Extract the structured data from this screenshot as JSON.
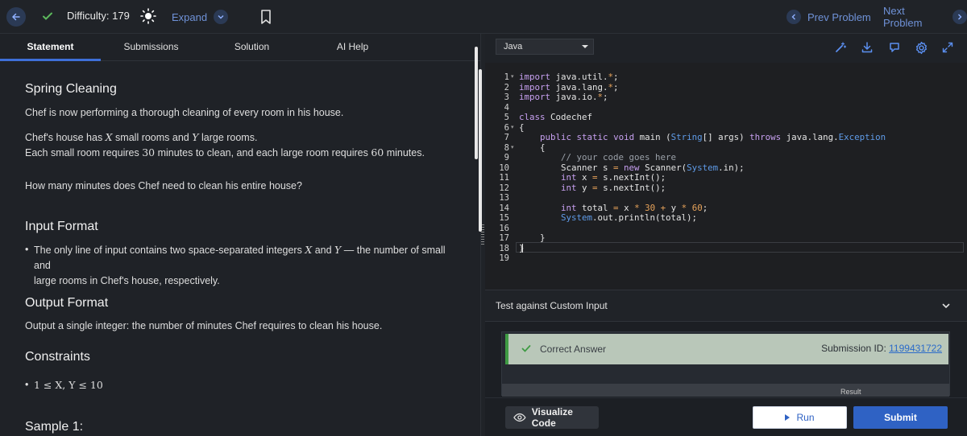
{
  "topbar": {
    "difficulty": "Difficulty: 179",
    "expand_label": "Expand",
    "prev_label": "Prev Problem",
    "next_label": "Next Problem"
  },
  "tabs": [
    {
      "label": "Statement"
    },
    {
      "label": "Submissions"
    },
    {
      "label": "Solution"
    },
    {
      "label": "AI Help"
    }
  ],
  "statement": {
    "title": "Spring Cleaning",
    "p1": "Chef is now performing a thorough cleaning of every room in his house.",
    "p2_a": "Chef's house has ",
    "var_x": "X",
    "p2_b": " small rooms and ",
    "var_y": "Y",
    "p2_c": " large rooms.",
    "p3_a": "Each small room requires ",
    "num_30": "30",
    "p3_b": " minutes to clean, and each large room requires ",
    "num_60": "60",
    "p3_c": " minutes.",
    "p4": "How many minutes does Chef need to clean his entire house?",
    "input_heading": "Input Format",
    "input_a": "The only line of input contains two space-separated integers ",
    "input_b": " and ",
    "input_c": " — the number of small and",
    "input_d": "large rooms in Chef's house, respectively.",
    "output_heading": "Output Format",
    "output_text": "Output a single integer: the number of minutes Chef requires to clean his house.",
    "constraints_heading": "Constraints",
    "constraint": "1 ≤ X, Y ≤ 10",
    "sample_heading": "Sample 1:"
  },
  "editor": {
    "language": "Java",
    "line_numbers": [
      "1",
      "2",
      "3",
      "4",
      "5",
      "6",
      "7",
      "8",
      "9",
      "10",
      "11",
      "12",
      "13",
      "14",
      "15",
      "16",
      "17",
      "18",
      "19"
    ]
  },
  "custom_input": {
    "label": "Test against Custom Input"
  },
  "result": {
    "status": "Correct Answer",
    "submission_label": "Submission ID: ",
    "submission_id": "1199431722",
    "column_header": "Result"
  },
  "actions": {
    "visualize_label": "Visualize Code",
    "run_label": "Run",
    "submit_label": "Submit"
  },
  "colors": {
    "accent": "#3e6fd8",
    "success": "#3f9b44",
    "submit": "#2f62c4"
  }
}
